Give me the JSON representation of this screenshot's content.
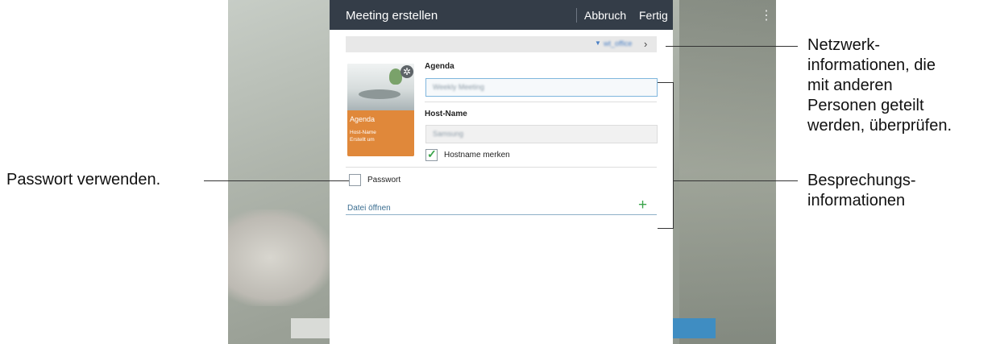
{
  "dialog": {
    "title": "Meeting erstellen",
    "cancel_label": "Abbruch",
    "done_label": "Fertig",
    "network_ssid": "wt_office"
  },
  "thumbnail": {
    "title": "Agenda",
    "host_line": "Host-Name",
    "created_line": "Erstellt um"
  },
  "form": {
    "agenda_label": "Agenda",
    "agenda_value": "Weekly Meeting",
    "host_label": "Host-Name",
    "host_value": "Samsung",
    "remember_host_label": "Hostname merken",
    "remember_host_checked": true,
    "password_label": "Passwort",
    "password_checked": false,
    "open_file_label": "Datei öffnen"
  },
  "callouts": {
    "network_info": [
      "Netzwerk-",
      "informationen, die",
      "mit anderen",
      "Personen geteilt",
      "werden, überprüfen."
    ],
    "meeting_info": [
      "Besprechungs-",
      "informationen"
    ],
    "use_password": "Passwort verwenden."
  },
  "colors": {
    "titlebar": "#343d48",
    "accent_green": "#3aa44a",
    "thumbnail_orange": "#e0883a",
    "background_button": "#3f8dc2"
  },
  "icons": {
    "wifi": "wifi-icon",
    "chevron": "chevron-right-icon",
    "gear": "gear-icon",
    "check": "check-icon",
    "plus": "plus-icon",
    "more": "more-vert-icon"
  }
}
